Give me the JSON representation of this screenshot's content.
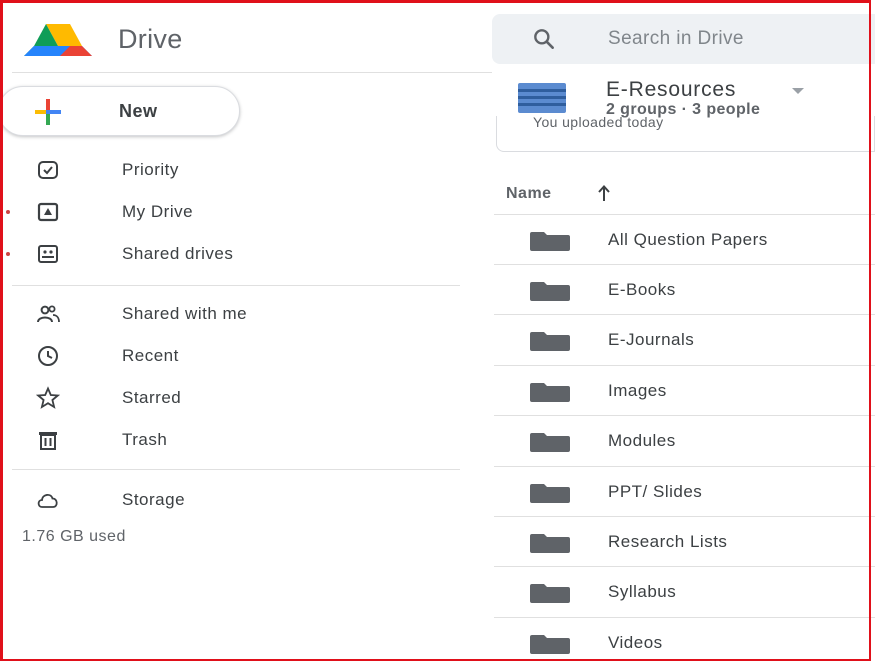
{
  "app": {
    "title": "Drive"
  },
  "search": {
    "placeholder": "Search in Drive"
  },
  "new_button": {
    "label": "New"
  },
  "nav": {
    "group1": [
      {
        "label": "Priority",
        "icon": "priority-icon"
      },
      {
        "label": "My Drive",
        "icon": "my-drive-icon"
      },
      {
        "label": "Shared drives",
        "icon": "shared-drives-icon"
      }
    ],
    "group2": [
      {
        "label": "Shared with me",
        "icon": "people-icon"
      },
      {
        "label": "Recent",
        "icon": "clock-icon"
      },
      {
        "label": "Starred",
        "icon": "star-icon"
      },
      {
        "label": "Trash",
        "icon": "trash-icon"
      }
    ],
    "storage": {
      "label": "Storage",
      "icon": "cloud-icon",
      "used": "1.76 GB used"
    }
  },
  "folder": {
    "title": "E-Resources",
    "subtitle": "2 groups · 3 people",
    "activity": "You uploaded today"
  },
  "table": {
    "header": "Name",
    "sort": "ascending",
    "rows": [
      "All Question Papers",
      "E-Books",
      "E-Journals",
      "Images",
      "Modules",
      "PPT/ Slides",
      "Research Lists",
      "Syllabus",
      "Videos"
    ]
  },
  "colors": {
    "frame": "#e0101a",
    "folder": "#5f6368",
    "text": "#3c4043",
    "search_bg": "#eef1f4"
  }
}
